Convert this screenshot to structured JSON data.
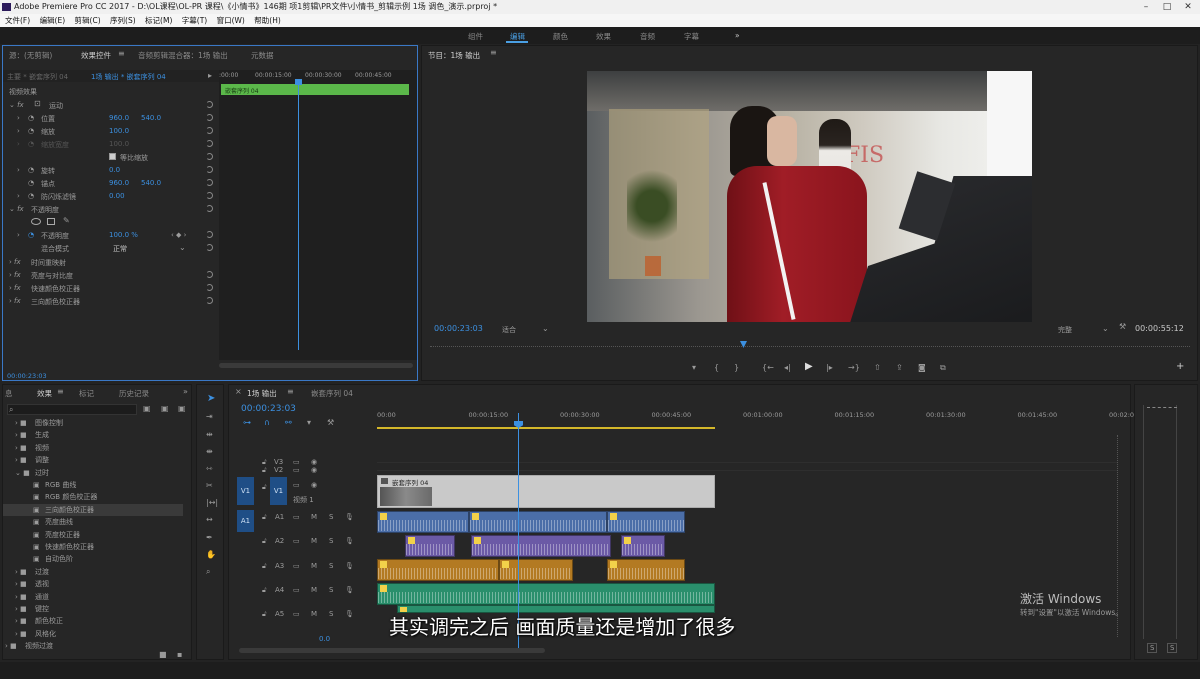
{
  "window": {
    "title": "Adobe Premiere Pro CC 2017 - D:\\OL课程\\OL-PR 课程\\《小情书》146期 项1剪辑\\PR文件\\小情书_剪辑示例 1场 调色_演示.prproj *"
  },
  "menu": [
    "文件(F)",
    "编辑(E)",
    "剪辑(C)",
    "序列(S)",
    "标记(M)",
    "字幕(T)",
    "窗口(W)",
    "帮助(H)"
  ],
  "workspaces": {
    "items": [
      "组件",
      "编辑",
      "颜色",
      "效果",
      "音频",
      "字幕"
    ],
    "active": "编辑",
    "more": "»"
  },
  "effect_controls": {
    "tabs": [
      "源：(无剪辑)",
      "效果控件",
      "音频剪辑混合器：1场 输出",
      "元数据"
    ],
    "active_tab": "效果控件",
    "source": "主要 * 嵌套序列 04",
    "sequence": "1场 输出 * 嵌套序列 04",
    "timecodes": [
      ":00:00",
      "00:00:15:00",
      "00:00:30:00",
      "00:00:45:00"
    ],
    "clip_label": "嵌套序列 04",
    "section": "视频效果",
    "motion": "运动",
    "position_label": "位置",
    "position_x": "960.0",
    "position_y": "540.0",
    "scale_label": "缩放",
    "scale": "100.0",
    "scale_width_label": "缩放宽度",
    "scale_width": "100.0",
    "uniform_label": "等比缩放",
    "rotation_label": "旋转",
    "rotation": "0.0",
    "anchor_label": "锚点",
    "anchor_x": "960.0",
    "anchor_y": "540.0",
    "flicker_label": "防闪烁滤镜",
    "flicker": "0.00",
    "opacity": "不透明度",
    "opacity_label": "不透明度",
    "opacity_value": "100.0 %",
    "blend_label": "混合模式",
    "blend_value": "正常",
    "time_remap": "时间重映射",
    "fx1": "亮度与对比度",
    "fx2": "快速颜色校正器",
    "fx3": "三向颜色校正器",
    "current_time": "00:00:23:03"
  },
  "program": {
    "title": "节目：1场 输出",
    "timecode": "00:00:23:03",
    "fit": "适合",
    "quality": "完整",
    "duration": "00:00:55:12",
    "video_caption": "FIS"
  },
  "effects_panel": {
    "tabs": [
      "息",
      "效果",
      "标记",
      "历史记录"
    ],
    "active_tab": "效果",
    "items": [
      {
        "label": "图像控制",
        "level": 1,
        "open": false
      },
      {
        "label": "生成",
        "level": 1,
        "open": false
      },
      {
        "label": "视频",
        "level": 1,
        "open": false
      },
      {
        "label": "调整",
        "level": 1,
        "open": false
      },
      {
        "label": "过时",
        "level": 1,
        "open": true
      },
      {
        "label": "RGB 曲线",
        "level": 2
      },
      {
        "label": "RGB 颜色校正器",
        "level": 2
      },
      {
        "label": "三向颜色校正器",
        "level": 2,
        "selected": true
      },
      {
        "label": "亮度曲线",
        "level": 2
      },
      {
        "label": "亮度校正器",
        "level": 2
      },
      {
        "label": "快速颜色校正器",
        "level": 2
      },
      {
        "label": "自动色阶",
        "level": 2
      },
      {
        "label": "过渡",
        "level": 1,
        "open": false
      },
      {
        "label": "透视",
        "level": 1,
        "open": false
      },
      {
        "label": "通道",
        "level": 1,
        "open": false
      },
      {
        "label": "键控",
        "level": 1,
        "open": false
      },
      {
        "label": "颜色校正",
        "level": 1,
        "open": false
      },
      {
        "label": "风格化",
        "level": 1,
        "open": false
      },
      {
        "label": "视频过渡",
        "level": 0,
        "open": false
      }
    ]
  },
  "timeline": {
    "tabs": [
      "1场 输出",
      "嵌套序列 04"
    ],
    "active_tab": "1场 输出",
    "timecode": "00:00:23:03",
    "ruler": [
      "00:00",
      "00:00:15:00",
      "00:00:30:00",
      "00:00:45:00",
      "00:01:00:00",
      "00:01:15:00",
      "00:01:30:00",
      "00:01:45:00",
      "00:02:0"
    ],
    "video_tracks": [
      "V3",
      "V2",
      "V1"
    ],
    "audio_tracks": [
      "A1",
      "A2",
      "A3",
      "A4",
      "A5"
    ],
    "v1_name": "视频 1",
    "nested_clip": "嵌套序列 04",
    "master_value": "0.0",
    "track_toggles": {
      "m": "M",
      "s": "S"
    }
  },
  "meter": {
    "labels": [
      "S",
      "S"
    ]
  },
  "subtitle": "其实调完之后 画面质量还是增加了很多",
  "watermark": {
    "line1": "激活 Windows",
    "line2": "转到\"设置\"以激活 Windows。"
  }
}
